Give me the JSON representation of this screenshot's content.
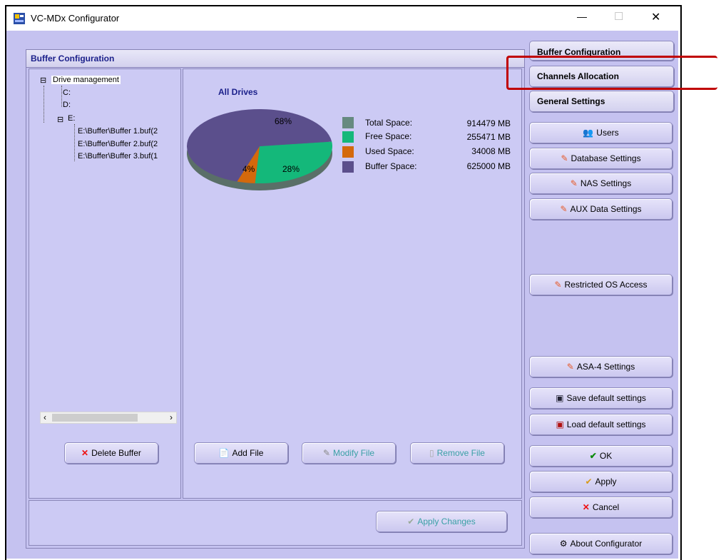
{
  "window": {
    "title": "VC-MDx Configurator",
    "controls": {
      "minimize": "—",
      "maximize": "☐",
      "close": "✕"
    }
  },
  "buffer_panel": {
    "title": "Buffer Configuration",
    "tree": {
      "root": "Drive management",
      "items": [
        "C:",
        "D:",
        "E:"
      ],
      "e_children": [
        "E:\\Buffer\\Buffer 1.buf(2",
        "E:\\Buffer\\Buffer 2.buf(2",
        "E:\\Buffer\\Buffer 3.buf(1"
      ],
      "expand_glyph": "⊟"
    },
    "delete_button": "Delete Buffer",
    "chart": {
      "title": "All Drives",
      "legend": [
        {
          "label": "Total Space:",
          "value": "914479 MB",
          "color": "#668a80"
        },
        {
          "label": "Free Space:",
          "value": "255471 MB",
          "color": "#14b87a"
        },
        {
          "label": "Used Space:",
          "value": "34008 MB",
          "color": "#d4690c"
        },
        {
          "label": "Buffer Space:",
          "value": "625000 MB",
          "color": "#5b4f8c"
        }
      ]
    },
    "file_buttons": {
      "add": "Add File",
      "modify": "Modify File",
      "remove": "Remove File"
    },
    "apply_changes": "Apply Changes"
  },
  "chart_data": {
    "type": "pie",
    "title": "All Drives",
    "slices": [
      {
        "label": "Buffer Space",
        "value": 68,
        "display": "68%",
        "color": "#5b4f8c"
      },
      {
        "label": "Free Space",
        "value": 28,
        "display": "28%",
        "color": "#14b87a"
      },
      {
        "label": "Used Space",
        "value": 4,
        "display": "4%",
        "color": "#d4690c"
      }
    ]
  },
  "right_panel": {
    "tabs": [
      "Buffer Configuration",
      "Channels Allocation",
      "General Settings"
    ],
    "buttons": {
      "users": "Users",
      "database": "Database Settings",
      "nas": "NAS Settings",
      "aux": "AUX Data Settings",
      "restricted": "Restricted OS Access",
      "asa4": "ASA-4 Settings",
      "save_default": "Save default settings",
      "load_default": "Load default settings",
      "ok": "OK",
      "apply": "Apply",
      "cancel": "Cancel",
      "about": "About Configurator"
    }
  },
  "highlight_color": "#c00000"
}
